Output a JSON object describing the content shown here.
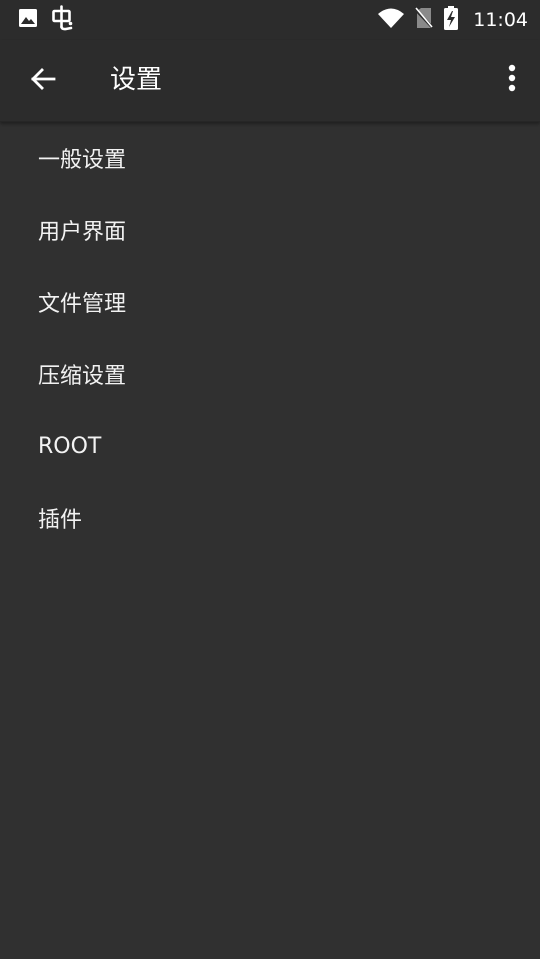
{
  "status_bar": {
    "left_icons": [
      "image-icon",
      "bug-app-icon"
    ],
    "right_icons": [
      "wifi-icon",
      "no-sim-icon",
      "battery-charging-icon"
    ],
    "time": "11:04"
  },
  "app_bar": {
    "title": "设置",
    "back_icon": "arrow-left-icon",
    "more_icon": "more-vertical-icon"
  },
  "menu": {
    "items": [
      {
        "label": "一般设置"
      },
      {
        "label": "用户界面"
      },
      {
        "label": "文件管理"
      },
      {
        "label": "压缩设置"
      },
      {
        "label": "ROOT"
      },
      {
        "label": "插件"
      }
    ]
  },
  "colors": {
    "background": "#303030",
    "bar": "#2c2c2c",
    "text": "#ffffff"
  }
}
